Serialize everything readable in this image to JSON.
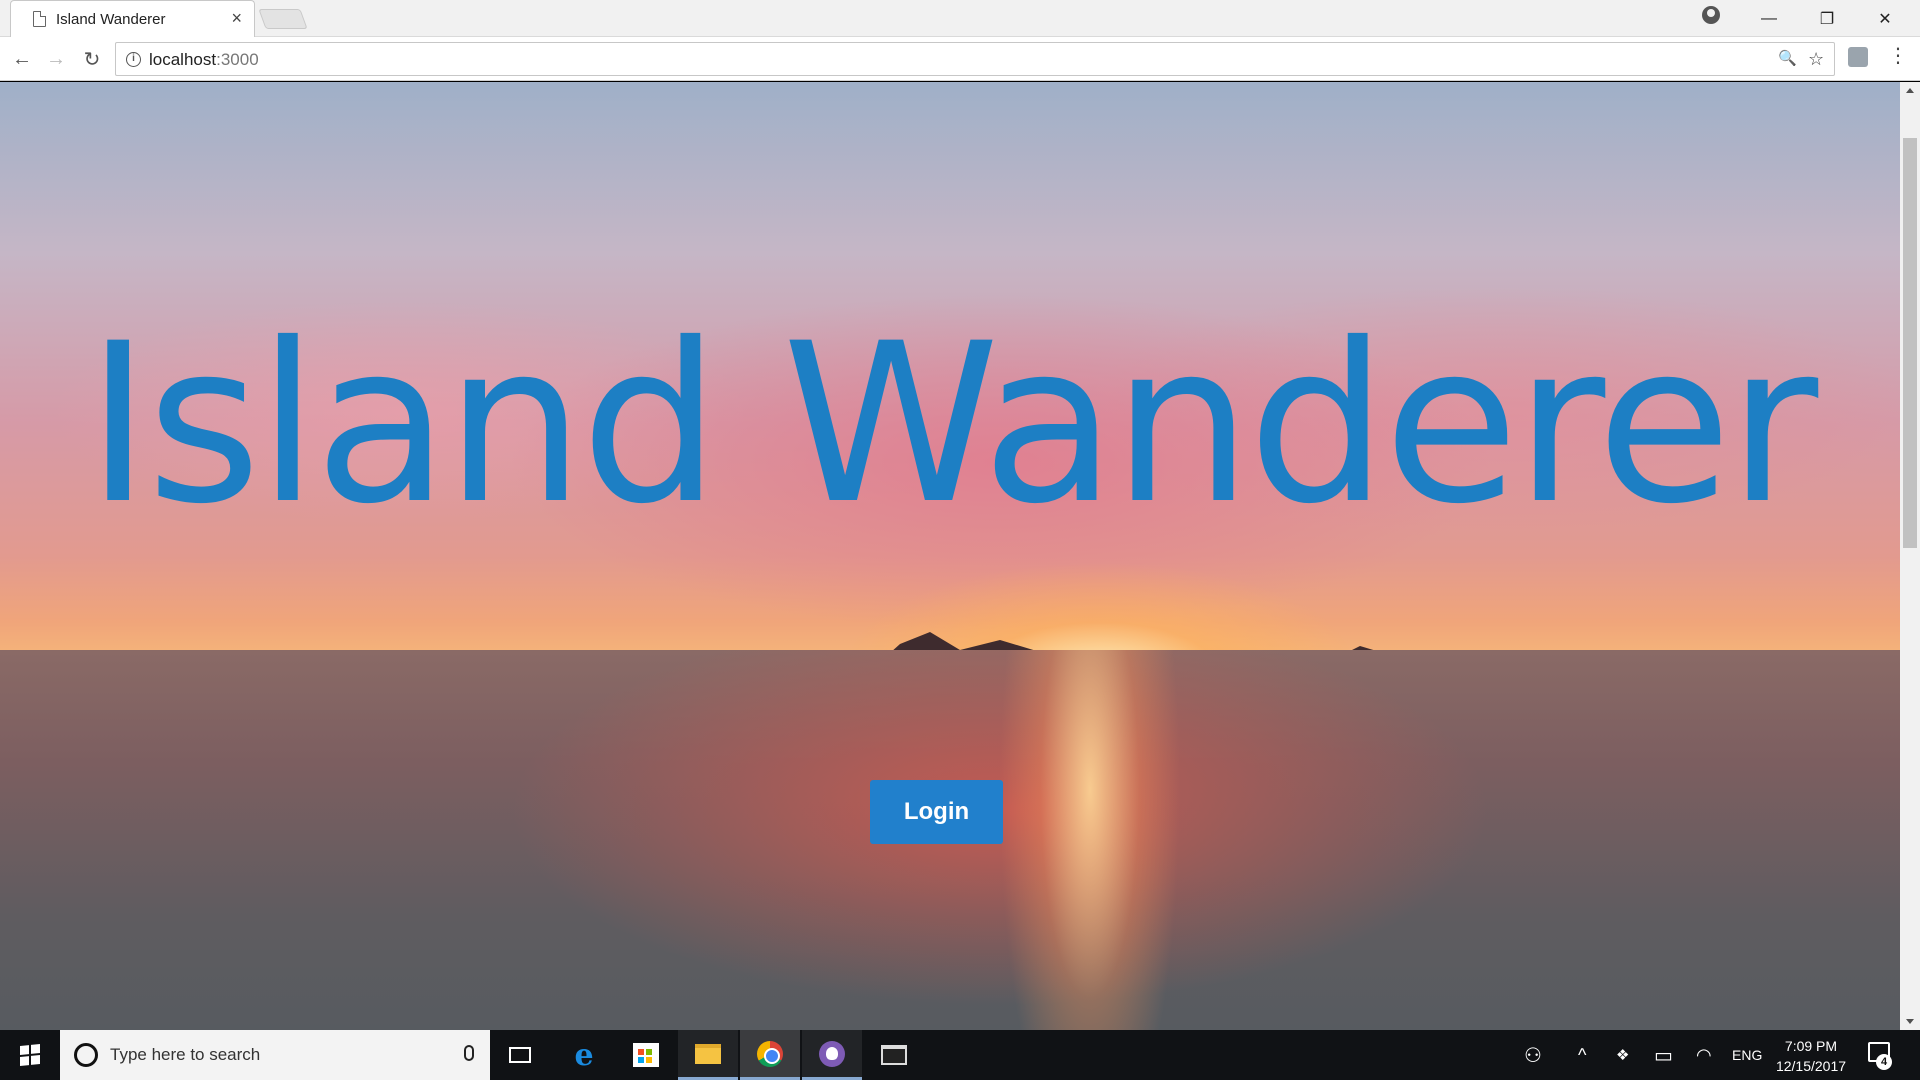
{
  "browser": {
    "tab_title": "Island Wanderer",
    "tab_close": "×",
    "url_host": "localhost",
    "url_port": ":3000",
    "info_glyph": "i",
    "window_controls": {
      "minimize": "—",
      "restore": "❐",
      "close": "✕"
    },
    "nav": {
      "back": "←",
      "forward": "→",
      "reload": "↻"
    },
    "omni": {
      "zoom": "🔍",
      "star": "☆",
      "menu": "⋮"
    }
  },
  "page": {
    "title": "Island Wanderer",
    "login_label": "Login"
  },
  "taskbar": {
    "search_placeholder": "Type here to search",
    "edge_glyph": "e",
    "tray": {
      "people": "⚇",
      "chevron": "^",
      "dropbox": "❖",
      "battery": "▭",
      "wifi": "◠",
      "lang": "ENG"
    },
    "time": "7:09 PM",
    "date": "12/15/2017",
    "notification_count": "4"
  }
}
